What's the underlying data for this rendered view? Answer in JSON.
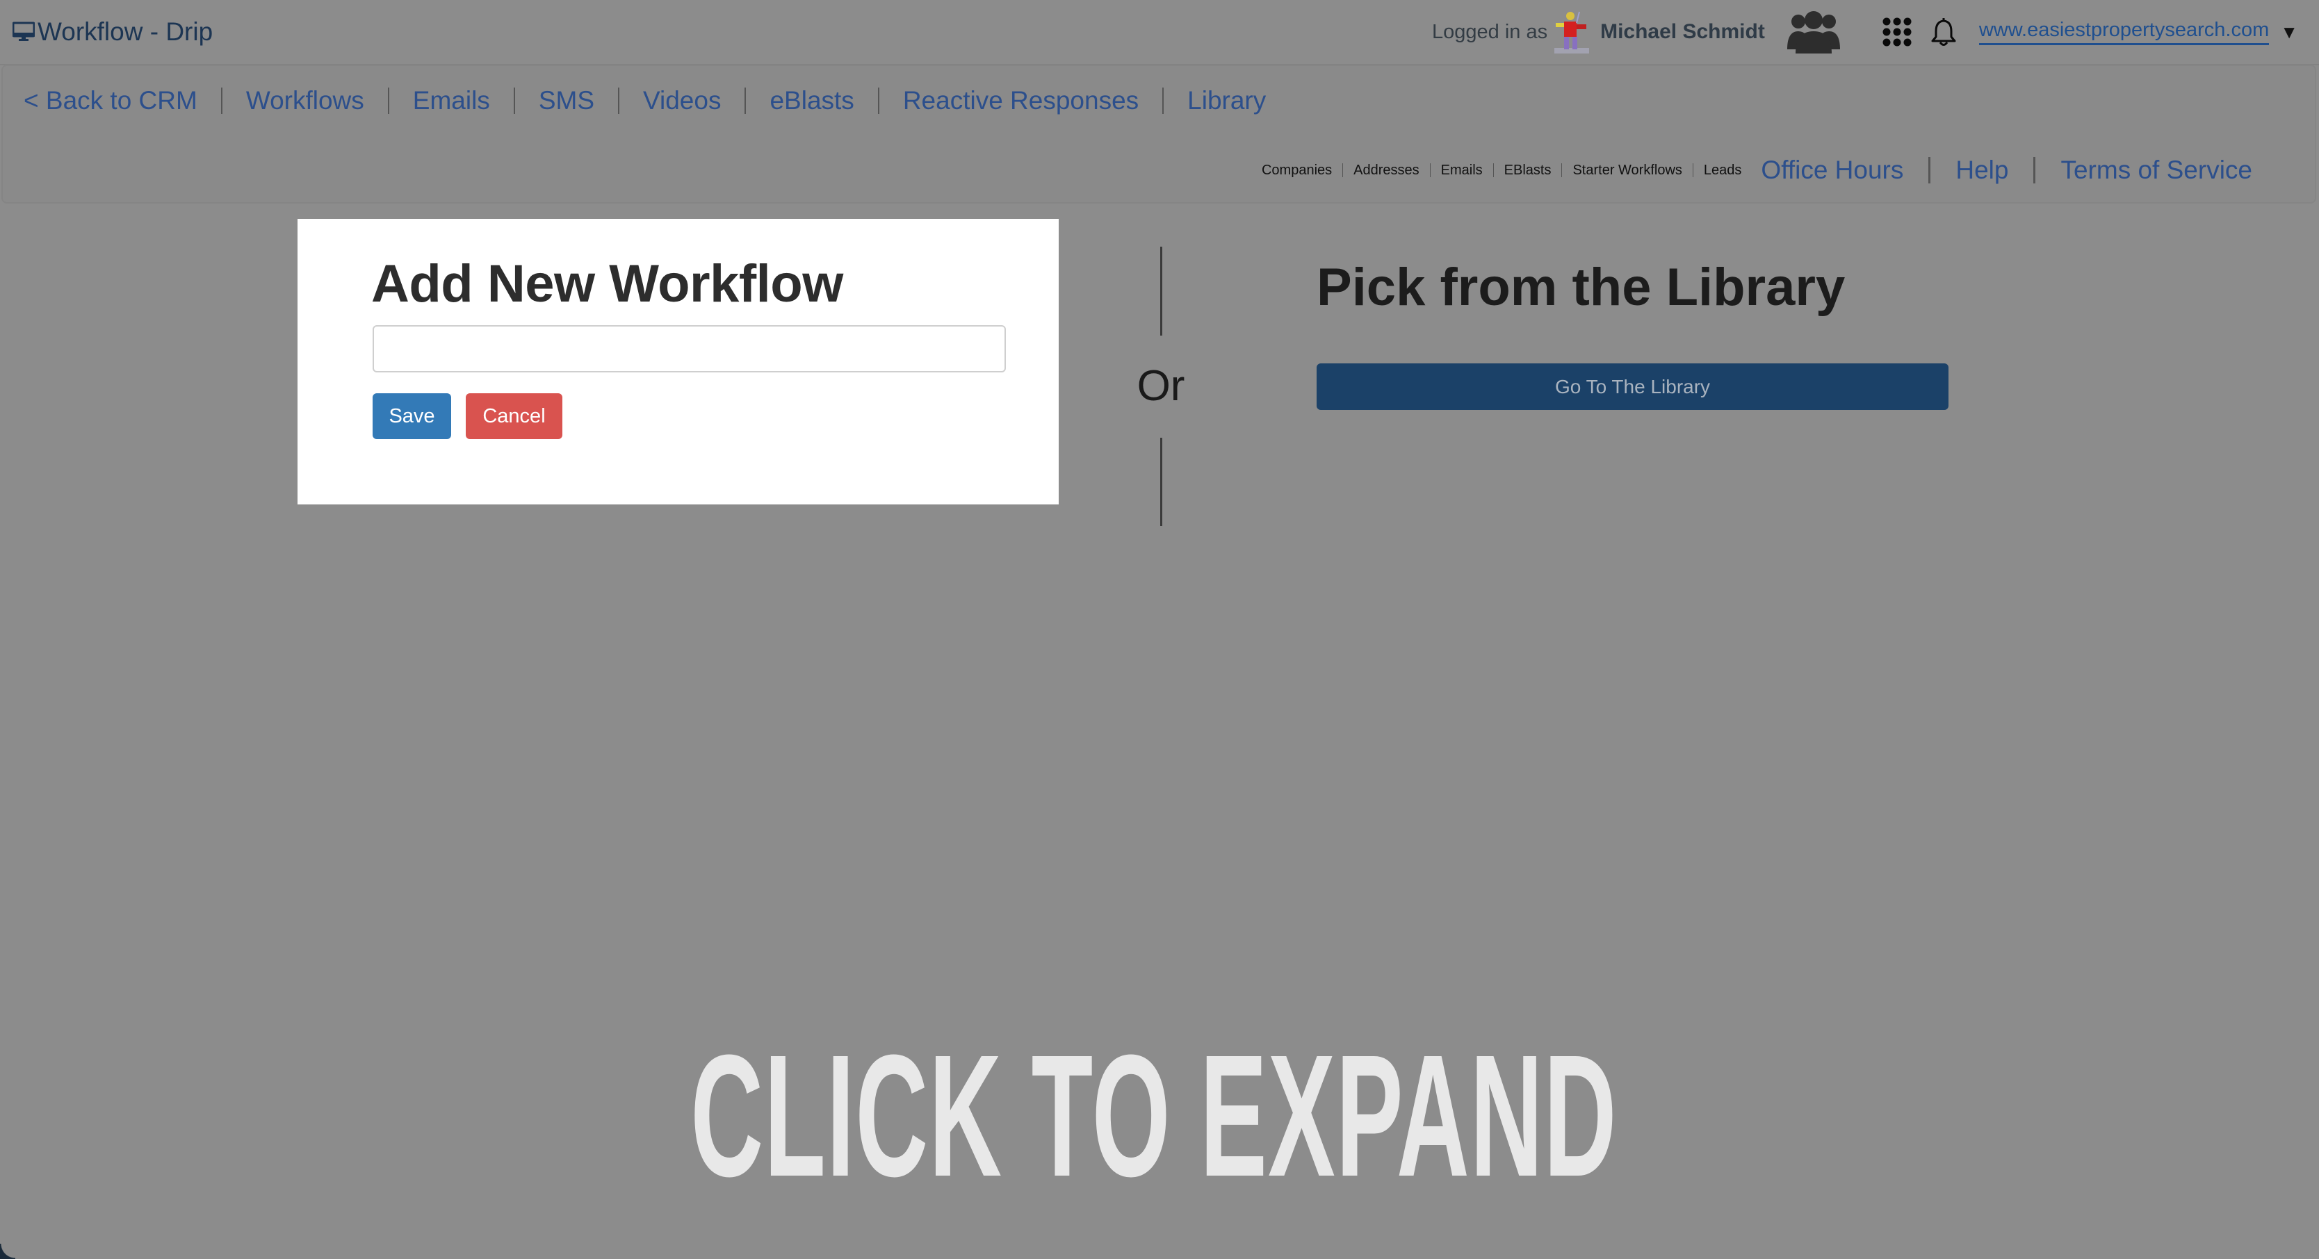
{
  "header": {
    "app_title": "Workflow - Drip",
    "app_icon": "monitor-icon",
    "logged_in_label": "Logged in as",
    "user_name": "Michael Schmidt",
    "icons": [
      "avatar",
      "group-icon",
      "apps-grid-icon",
      "bell-icon"
    ],
    "site_link": "www.easiestpropertysearch.com",
    "site_caret": "▼"
  },
  "main_nav": [
    {
      "label": "< Back to CRM"
    },
    {
      "label": "Workflows"
    },
    {
      "label": "Emails"
    },
    {
      "label": "SMS"
    },
    {
      "label": "Videos"
    },
    {
      "label": "eBlasts"
    },
    {
      "label": "Reactive Responses"
    },
    {
      "label": "Library"
    }
  ],
  "sub_nav": {
    "small_links": [
      {
        "label": "Companies"
      },
      {
        "label": "Addresses"
      },
      {
        "label": "Emails"
      },
      {
        "label": "EBlasts"
      },
      {
        "label": "Starter Workflows"
      },
      {
        "label": "Leads"
      }
    ],
    "large_links": [
      {
        "label": "Office Hours"
      },
      {
        "label": "Help"
      },
      {
        "label": "Terms of Service"
      }
    ]
  },
  "add_workflow": {
    "title": "Add New Workflow",
    "name_input_value": "",
    "name_input_placeholder": "",
    "save_label": "Save",
    "cancel_label": "Cancel"
  },
  "divider": {
    "or_label": "Or"
  },
  "library": {
    "title": "Pick from the Library",
    "button_label": "Go To The Library"
  },
  "overlay": {
    "expand_label": "CLICK TO EXPAND"
  },
  "colors": {
    "backdrop": "#8c8c8c",
    "link": "#2c4f8c",
    "save_button": "#337ab7",
    "cancel_button": "#d9534f",
    "library_button": "#1b4168",
    "title_dark": "#1c3553"
  }
}
